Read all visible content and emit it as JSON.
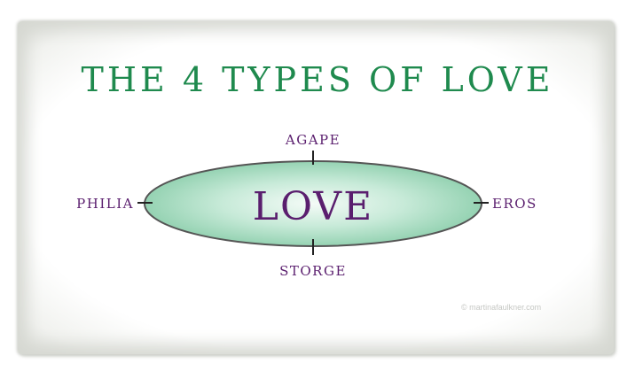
{
  "title": "THE 4 TYPES OF LOVE",
  "center_label": "LOVE",
  "branches": {
    "top": "AGAPE",
    "bottom": "STORGE",
    "left": "PHILIA",
    "right": "EROS"
  },
  "watermark": "© martinafaulkner.com",
  "colors": {
    "title": "#1f8a4e",
    "labels": "#5a1e6e",
    "ellipse_fill": "#8fd1b0",
    "ellipse_stroke": "#555555"
  }
}
